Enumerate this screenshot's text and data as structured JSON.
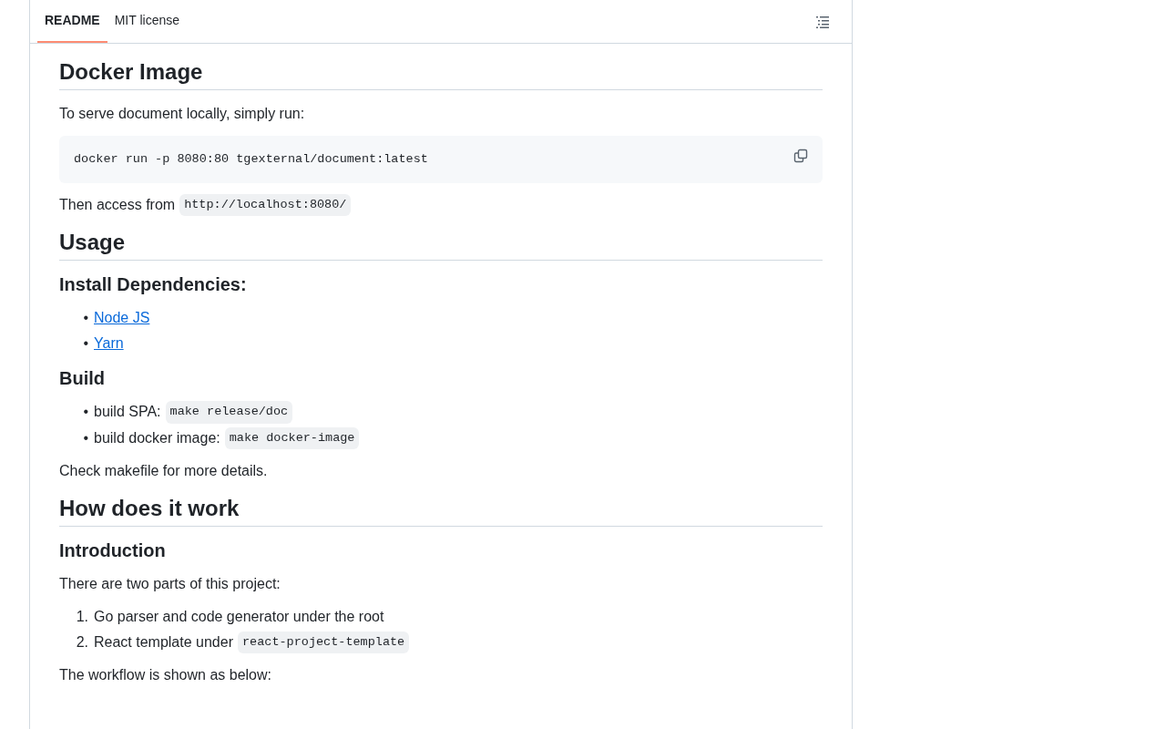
{
  "tabs": [
    {
      "label": "README",
      "selected": true
    },
    {
      "label": "MIT license",
      "selected": false
    }
  ],
  "blocks": [
    {
      "kind": "h2",
      "text": "Docker Image"
    },
    {
      "kind": "p",
      "parts": [
        {
          "text": "To serve document locally, simply run:"
        }
      ]
    },
    {
      "kind": "pre",
      "text": "docker run -p 8080:80 tgexternal/document:latest"
    },
    {
      "kind": "p",
      "parts": [
        {
          "text": "Then access from"
        },
        {
          "code": "http://localhost:8080/"
        }
      ]
    },
    {
      "kind": "h2",
      "text": "Usage"
    },
    {
      "kind": "h3",
      "text": "Install Dependencies:"
    },
    {
      "kind": "ul",
      "items": [
        {
          "marker": "•",
          "parts": [
            {
              "link": "Node JS"
            }
          ]
        },
        {
          "marker": "•",
          "parts": [
            {
              "link": "Yarn"
            }
          ]
        }
      ]
    },
    {
      "kind": "h3",
      "text": "Build"
    },
    {
      "kind": "ul",
      "items": [
        {
          "marker": "•",
          "parts": [
            {
              "text": "build SPA:"
            },
            {
              "code": "make release/doc"
            }
          ]
        },
        {
          "marker": "•",
          "parts": [
            {
              "text": "build docker image:"
            },
            {
              "code": "make docker-image"
            }
          ]
        }
      ]
    },
    {
      "kind": "p",
      "parts": [
        {
          "text": "Check makefile for more details."
        }
      ]
    },
    {
      "kind": "h2",
      "text": "How does it work"
    },
    {
      "kind": "h3",
      "text": "Introduction"
    },
    {
      "kind": "p",
      "parts": [
        {
          "text": "There are two parts of this project:"
        }
      ]
    },
    {
      "kind": "ol",
      "items": [
        {
          "marker": "1.",
          "parts": [
            {
              "text": "Go parser and code generator under the root"
            }
          ]
        },
        {
          "marker": "2.",
          "parts": [
            {
              "text": "React template under"
            },
            {
              "code": "react-project-template"
            }
          ]
        }
      ]
    },
    {
      "kind": "p",
      "parts": [
        {
          "text": "The workflow is shown as below:"
        }
      ]
    }
  ]
}
